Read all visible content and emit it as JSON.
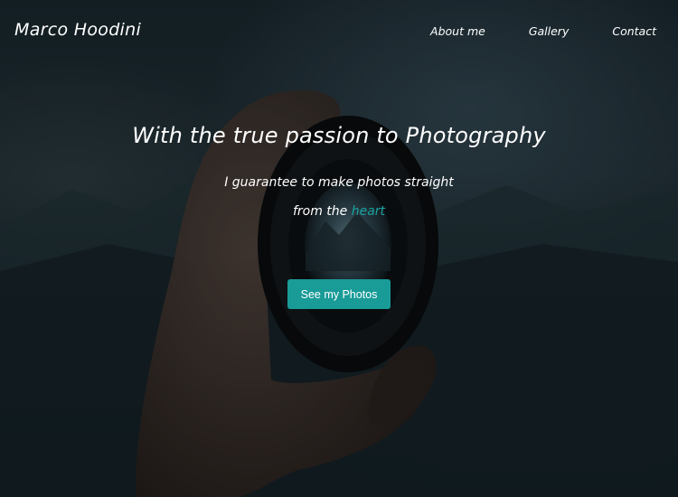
{
  "nav": {
    "brand": "Marco Hoodini",
    "links": [
      "About me",
      "Gallery",
      "Contact"
    ]
  },
  "hero": {
    "headline": "With the true passion to Photography",
    "subtitle_line1": "I guarantee to make photos straight",
    "subtitle_line2_prefix": "from the ",
    "subtitle_line2_accent": "heart",
    "cta_label": "See my Photos"
  },
  "colors": {
    "accent": "#199b98",
    "text": "#ffffff",
    "overlay": "#0e1a1f"
  }
}
